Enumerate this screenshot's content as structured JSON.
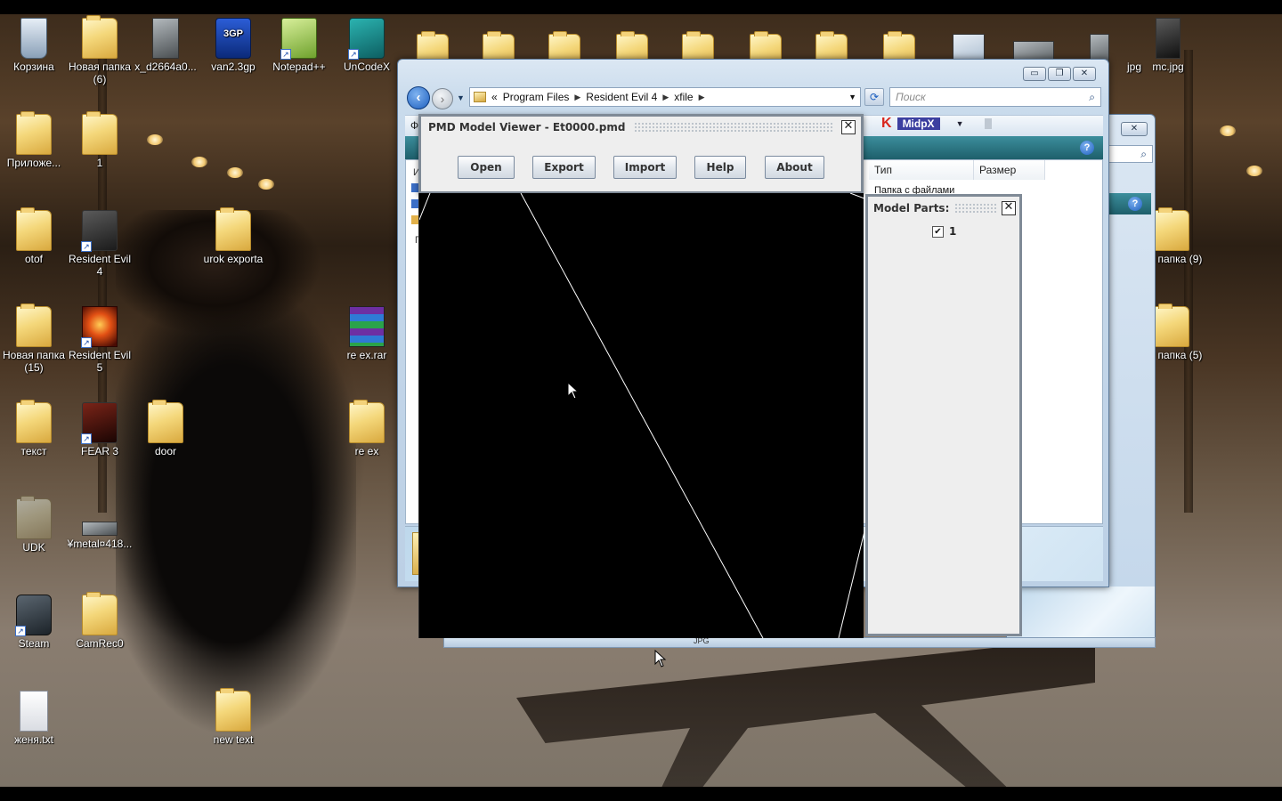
{
  "desktop": {
    "icons": [
      {
        "label": "Корзина",
        "icon": "recycle-bin-icon"
      },
      {
        "label": "Новая папка (6)",
        "icon": "folder-icon"
      },
      {
        "label": "x_d2664a0...",
        "icon": "image-file-icon"
      },
      {
        "label": "van2.3gp",
        "icon": "video-3gp-icon"
      },
      {
        "label": "Notepad++",
        "icon": "notepad-plus-plus-icon"
      },
      {
        "label": "UnCodeX",
        "icon": "uncodex-book-icon"
      },
      {
        "label": "Приложе...",
        "icon": "folder-icon"
      },
      {
        "label": "1",
        "icon": "folder-icon"
      },
      {
        "label": "otof",
        "icon": "folder-icon"
      },
      {
        "label": "Resident Evil 4",
        "icon": "resident-evil-4-icon"
      },
      {
        "label": "urok exporta",
        "icon": "folder-icon"
      },
      {
        "label": "Новая папка (15)",
        "icon": "folder-icon"
      },
      {
        "label": "Resident Evil 5",
        "icon": "resident-evil-5-icon"
      },
      {
        "label": "re ex.rar",
        "icon": "winrar-archive-icon"
      },
      {
        "label": "текст",
        "icon": "folder-icon"
      },
      {
        "label": "FEAR 3",
        "icon": "fear3-game-icon"
      },
      {
        "label": "door",
        "icon": "folder-icon"
      },
      {
        "label": "re ex",
        "icon": "folder-icon"
      },
      {
        "label": "UDK",
        "icon": "folder-icon"
      },
      {
        "label": "¥metal¤418...",
        "icon": "image-file-icon"
      },
      {
        "label": "Steam",
        "icon": "steam-icon"
      },
      {
        "label": "CamRec0",
        "icon": "folder-icon"
      },
      {
        "label": "женя.txt",
        "icon": "text-file-icon"
      },
      {
        "label": "new text",
        "icon": "folder-icon"
      },
      {
        "label": "mc.jpg",
        "icon": "image-file-icon"
      },
      {
        "label": "jpg",
        "icon": "image-file-icon"
      },
      {
        "label": "ая папка (9)",
        "icon": "folder-icon"
      },
      {
        "label": "ая папка (5)",
        "icon": "folder-icon"
      }
    ]
  },
  "explorer": {
    "breadcrumb": {
      "prefix": "«",
      "items": [
        "Program Files",
        "Resident Evil 4",
        "xfile"
      ]
    },
    "search_placeholder": "Поиск",
    "columns": [
      "Тип",
      "Размер"
    ],
    "row_type": "Папка с файлами",
    "toolbar_brand": "MidpX",
    "left_letter": "Ф",
    "left_letter2": "И",
    "left_letter3": "П",
    "footer_text": "JPG"
  },
  "pmd_viewer": {
    "title": "PMD Model Viewer - Et0000.pmd",
    "buttons": [
      "Open",
      "Export",
      "Import",
      "Help",
      "About"
    ]
  },
  "model_parts": {
    "title": "Model Parts:",
    "items": [
      {
        "label": "1",
        "checked": true
      }
    ]
  },
  "colors": {
    "viewport_bg": "#000000",
    "window_accent": "#1e5f6b",
    "explorer_chrome": "#c9dbec"
  }
}
